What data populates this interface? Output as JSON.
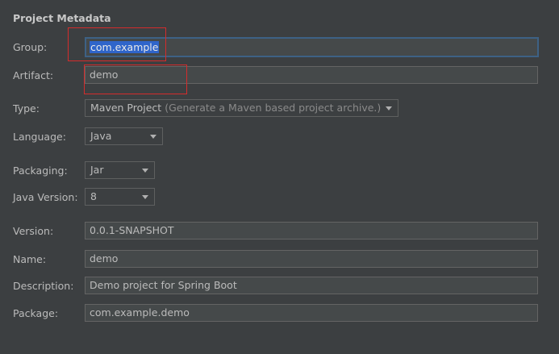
{
  "section_title": "Project Metadata",
  "fields": {
    "group": {
      "label": "Group:",
      "value": "com.example"
    },
    "artifact": {
      "label": "Artifact:",
      "value": "demo"
    },
    "type": {
      "label": "Type:",
      "value": "Maven Project",
      "hint": "(Generate a Maven based project archive.)"
    },
    "language": {
      "label": "Language:",
      "value": "Java"
    },
    "packaging": {
      "label": "Packaging:",
      "value": "Jar"
    },
    "java_version": {
      "label": "Java Version:",
      "value": "8"
    },
    "version": {
      "label": "Version:",
      "value": "0.0.1-SNAPSHOT"
    },
    "name": {
      "label": "Name:",
      "value": "demo"
    },
    "description": {
      "label": "Description:",
      "value": "Demo project for Spring Boot"
    },
    "package": {
      "label": "Package:",
      "value": "com.example.demo"
    }
  },
  "colors": {
    "background": "#3c3f41",
    "field_background": "#45494a",
    "focus_border": "#3d6185",
    "selection": "#2f65ca",
    "annotation_red": "#d42c2c"
  },
  "icons": {
    "dropdown": "chevron-down-icon"
  }
}
